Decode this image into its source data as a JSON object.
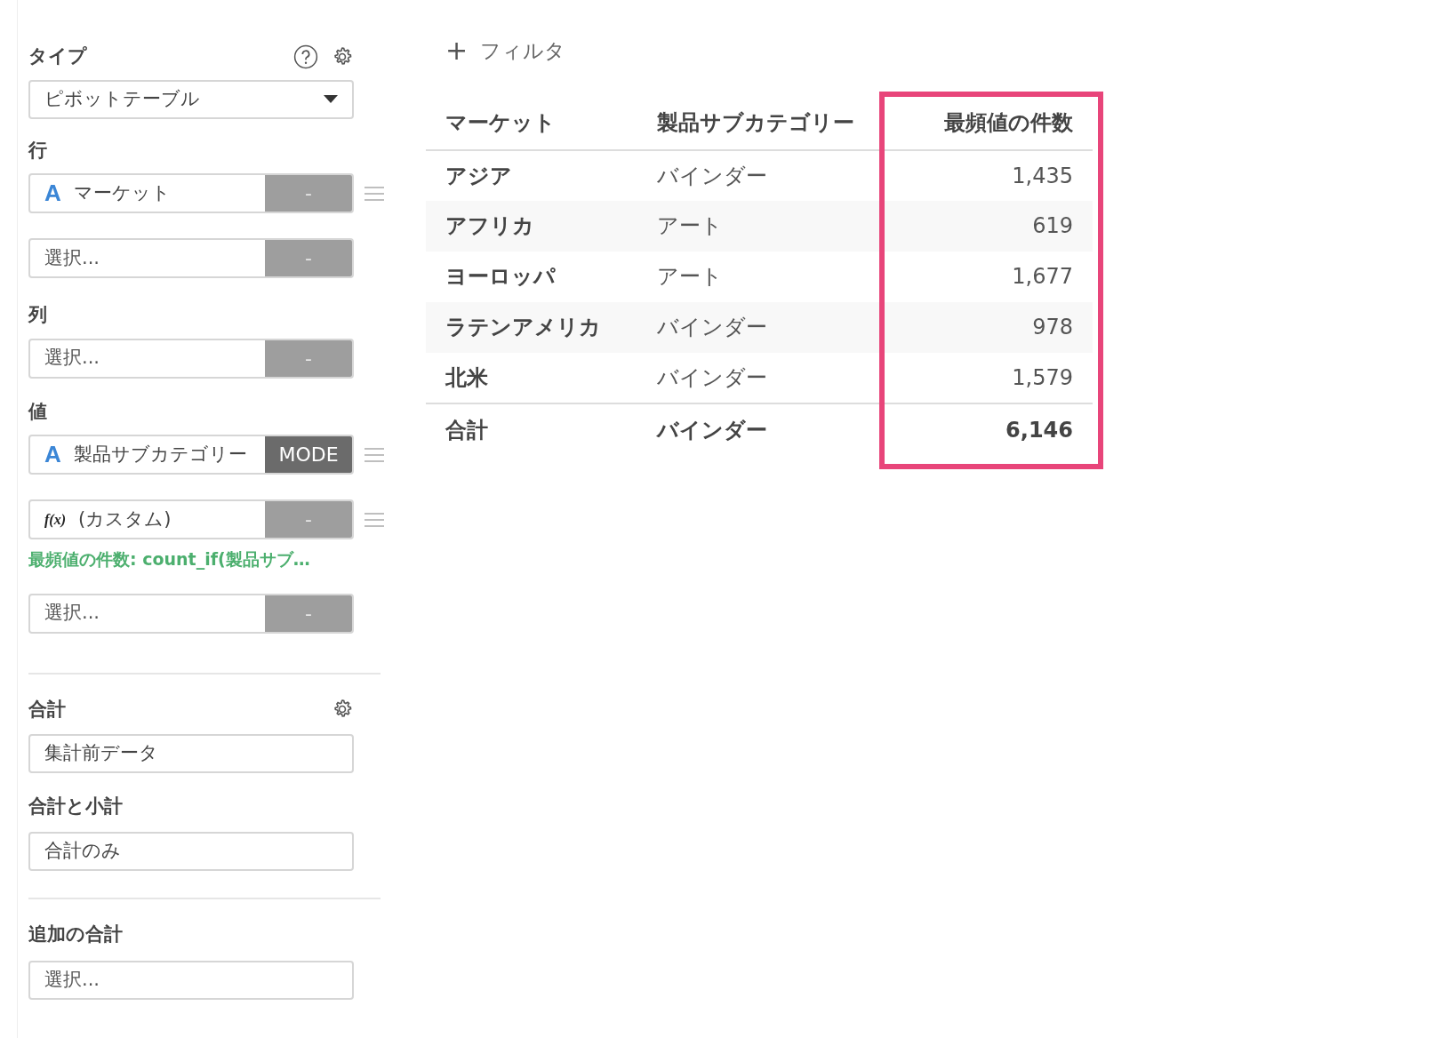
{
  "sidebar": {
    "type_section": {
      "label": "タイプ",
      "select": {
        "value": "ピボットテーブル"
      }
    },
    "rows_section": {
      "label": "行",
      "fields": [
        {
          "icon": "A",
          "kind": "letter",
          "value": "マーケット",
          "button": {
            "label": "-",
            "active": false
          },
          "draggable": true
        },
        {
          "placeholder": "選択...",
          "button": {
            "label": "-",
            "active": false
          },
          "draggable": false
        }
      ]
    },
    "columns_section": {
      "label": "列",
      "fields": [
        {
          "placeholder": "選択...",
          "button": {
            "label": "-",
            "active": false
          },
          "draggable": false
        }
      ]
    },
    "values_section": {
      "label": "値",
      "fields": [
        {
          "icon": "A",
          "kind": "letter",
          "value": "製品サブカテゴリー",
          "button": {
            "label": "MODE",
            "active": true
          },
          "draggable": true
        },
        {
          "icon": "f(x)",
          "kind": "function",
          "value": "(カスタム)",
          "button": {
            "label": "-",
            "active": false
          },
          "draggable": true,
          "note": "最頻値の件数: count_if(製品サブ…"
        },
        {
          "placeholder": "選択...",
          "button": {
            "label": "-",
            "active": false
          },
          "draggable": false
        }
      ]
    },
    "totals_section": {
      "label": "合計",
      "select": {
        "value": "集計前データ"
      }
    },
    "subtotals_section": {
      "label": "合計と小計",
      "select": {
        "value": "合計のみ"
      }
    },
    "extra_totals_section": {
      "label": "追加の合計",
      "select": {
        "placeholder": "選択..."
      }
    }
  },
  "filter_button": {
    "icon": "+",
    "label": "フィルタ"
  },
  "table": {
    "columns": [
      {
        "label": "マーケット",
        "kind": "text",
        "highlighted": false
      },
      {
        "label": "製品サブカテゴリー",
        "kind": "text",
        "highlighted": false
      },
      {
        "label": "最頻値の件数",
        "kind": "number",
        "highlighted": true
      }
    ],
    "rows": [
      [
        "アジア",
        "バインダー",
        "1,435"
      ],
      [
        "アフリカ",
        "アート",
        "619"
      ],
      [
        "ヨーロッパ",
        "アート",
        "1,677"
      ],
      [
        "ラテンアメリカ",
        "バインダー",
        "978"
      ],
      [
        "北米",
        "バインダー",
        "1,579"
      ]
    ],
    "total_row": [
      "合計",
      "バインダー",
      "6,146"
    ]
  }
}
